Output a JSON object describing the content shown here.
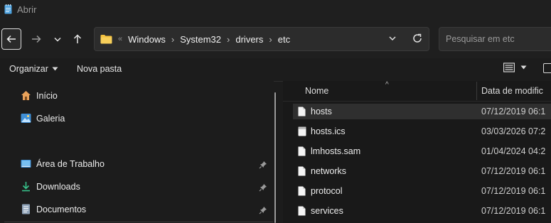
{
  "window": {
    "title": "Abrir"
  },
  "address": {
    "breadcrumbs": [
      "Windows",
      "System32",
      "drivers",
      "etc"
    ],
    "overflow": "«"
  },
  "search": {
    "placeholder": "Pesquisar em etc"
  },
  "toolbar": {
    "organize_label": "Organizar",
    "new_folder_label": "Nova pasta"
  },
  "sidebar": {
    "items": [
      {
        "label": "Início",
        "icon": "home-icon"
      },
      {
        "label": "Galeria",
        "icon": "gallery-icon"
      },
      {
        "label": "Área de Trabalho",
        "icon": "desktop-icon"
      },
      {
        "label": "Downloads",
        "icon": "download-icon"
      },
      {
        "label": "Documentos",
        "icon": "documents-icon"
      }
    ]
  },
  "file_list": {
    "columns": {
      "name": "Nome",
      "date": "Data de modific"
    },
    "rows": [
      {
        "name": "hosts",
        "date": "07/12/2019 06:1",
        "selected": true
      },
      {
        "name": "hosts.ics",
        "date": "03/03/2026 07:2",
        "selected": false
      },
      {
        "name": "lmhosts.sam",
        "date": "01/04/2024 04:2",
        "selected": false
      },
      {
        "name": "networks",
        "date": "07/12/2019 06:1",
        "selected": false
      },
      {
        "name": "protocol",
        "date": "07/12/2019 06:1",
        "selected": false
      },
      {
        "name": "services",
        "date": "07/12/2019 06:1",
        "selected": false
      }
    ]
  },
  "colors": {
    "background": "#1c1c1c",
    "folder": "#f3c13f",
    "accent_blue": "#4ea3e0"
  }
}
